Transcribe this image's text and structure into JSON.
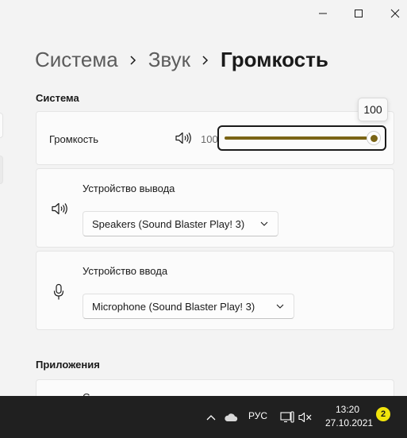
{
  "window": {
    "controls": [
      "minimize-icon",
      "maximize-icon",
      "close-icon"
    ]
  },
  "breadcrumb": {
    "items": [
      "Система",
      "Звук"
    ],
    "current": "Громкость"
  },
  "sections": {
    "system_title": "Система",
    "apps_title": "Приложения"
  },
  "volume": {
    "label": "Громкость",
    "value": "100",
    "tooltip": "100",
    "level_percent": 100
  },
  "output_device": {
    "title": "Устройство вывода",
    "selected": "Speakers (Sound Blaster Play! 3)"
  },
  "input_device": {
    "title": "Устройство ввода",
    "selected": "Microphone (Sound Blaster Play! 3)"
  },
  "apps": {
    "partial_text": "С"
  },
  "taskbar": {
    "language": "РУС",
    "time": "13:20",
    "date": "27.10.2021",
    "notifications": "2"
  },
  "colors": {
    "accent": "#7a6415",
    "taskbar_bg": "#202020",
    "badge": "#f1e40c"
  }
}
